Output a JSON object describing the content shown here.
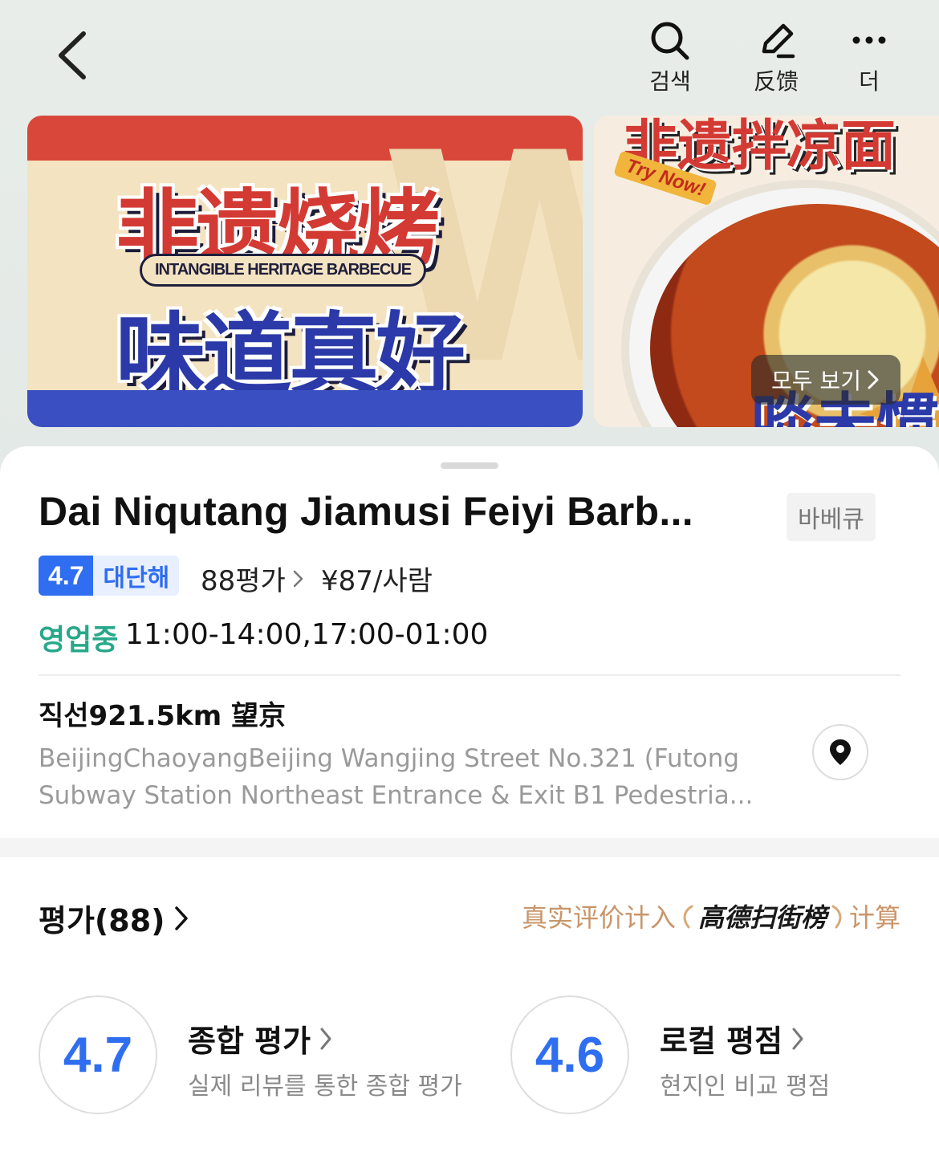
{
  "nav": {
    "search_label": "검색",
    "feedback_label": "反馈",
    "more_label": "더"
  },
  "banners": {
    "first": {
      "headline_top": "非遗烧烤",
      "pill": "INTANGIBLE HERITAGE BARBECUE",
      "headline_bottom": "味道真好",
      "ghost_letter": "W"
    },
    "second": {
      "headline": "非遗拌凉面",
      "tag": "Try Now!",
      "bottom_text": "啖未惯"
    },
    "view_all_label": "모두 보기"
  },
  "restaurant": {
    "name": "Dai Niqutang Jiamusi Feiyi Barb...",
    "category": "바베큐",
    "rating": "4.7",
    "rating_word": "대단해",
    "review_count_label": "88평가",
    "price": "¥87/사람",
    "open_status": "영업중",
    "hours": "11:00-14:00,17:00-01:00",
    "distance_area": "직선921.5km 望京",
    "address_line1": "BeijingChaoyangBeijing Wangjing Street No.321 (Futong",
    "address_line2": "Subway Station Northeast Entrance & Exit B1 Pedestria..."
  },
  "reviews": {
    "header": "평가(88)",
    "note_prefix": "真实评价计入",
    "note_brand": "高德扫街榜",
    "note_suffix": "计算",
    "overall": {
      "score": "4.7",
      "title": "종합 평가",
      "subtitle": "실제 리뷰를 통한 종합 평가"
    },
    "local": {
      "score": "4.6",
      "title": "로컬 평점",
      "subtitle": "현지인 비교 평점"
    }
  },
  "colors": {
    "accent_blue": "#2f6ef0",
    "open_green": "#27a88a",
    "gaode_gold": "#c9956a"
  }
}
